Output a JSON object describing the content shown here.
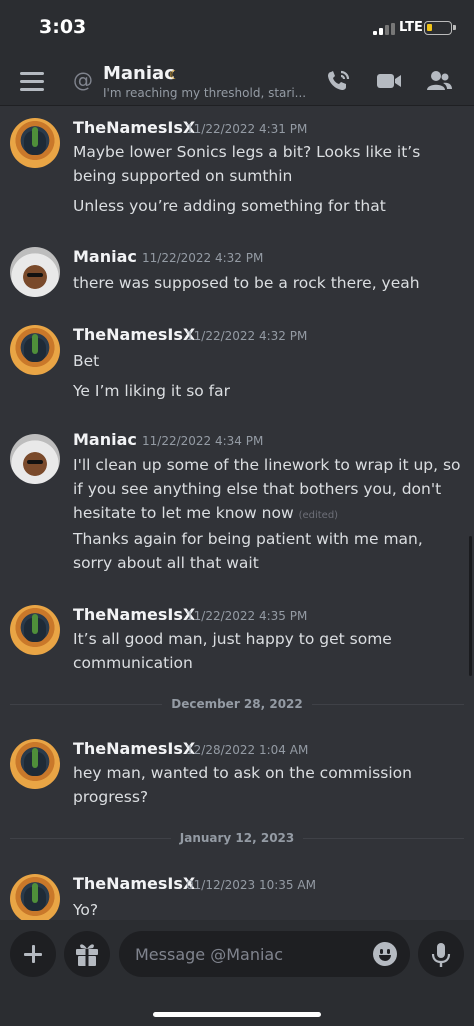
{
  "status": {
    "time": "3:03",
    "network": "LTE"
  },
  "header": {
    "title": "Maniac",
    "subtitle": "I'm reaching my threshold, stari..."
  },
  "messages": [
    {
      "author": "TheNamesIsX",
      "timestamp": "11/22/2022 4:31 PM",
      "avatar": "thenamesisx-avatar",
      "lines": [
        "Maybe lower Sonics legs a bit? Looks like it’s being supported on sumthin",
        "Unless you’re adding something for that"
      ]
    },
    {
      "author": "Maniac",
      "timestamp": "11/22/2022 4:32 PM",
      "avatar": "maniac-avatar",
      "lines": [
        "there was supposed to be a rock there, yeah"
      ]
    },
    {
      "author": "TheNamesIsX",
      "timestamp": "11/22/2022 4:32 PM",
      "avatar": "thenamesisx-avatar",
      "lines": [
        "Bet",
        "Ye I’m liking it so far"
      ]
    },
    {
      "author": "Maniac",
      "timestamp": "11/22/2022 4:34 PM",
      "avatar": "maniac-avatar",
      "lines": [
        "I'll clean up some of the linework to wrap it up, so if you see anything else that bothers you, don't hesitate to let me know now",
        "Thanks again for being patient with me man, sorry about all that wait"
      ],
      "edited_label": "(edited)"
    },
    {
      "author": "TheNamesIsX",
      "timestamp": "11/22/2022 4:35 PM",
      "avatar": "thenamesisx-avatar",
      "lines": [
        "It’s all good man, just happy to get some communication"
      ]
    },
    {
      "author": "TheNamesIsX",
      "timestamp": "12/28/2022 1:04 AM",
      "avatar": "thenamesisx-avatar",
      "lines": [
        "hey man, wanted to ask on the commission progress?"
      ]
    },
    {
      "author": "TheNamesIsX",
      "timestamp": "01/12/2023 10:35 AM",
      "avatar": "thenamesisx-avatar",
      "lines": [
        "Yo?"
      ]
    }
  ],
  "dividers": [
    "December 28, 2022",
    "January 12, 2023"
  ],
  "composer": {
    "placeholder": "Message @Maniac"
  },
  "colors": {
    "background": "#313338",
    "bar": "#2b2d31",
    "input": "#1e1f22",
    "status_moon": "#f0b232"
  }
}
